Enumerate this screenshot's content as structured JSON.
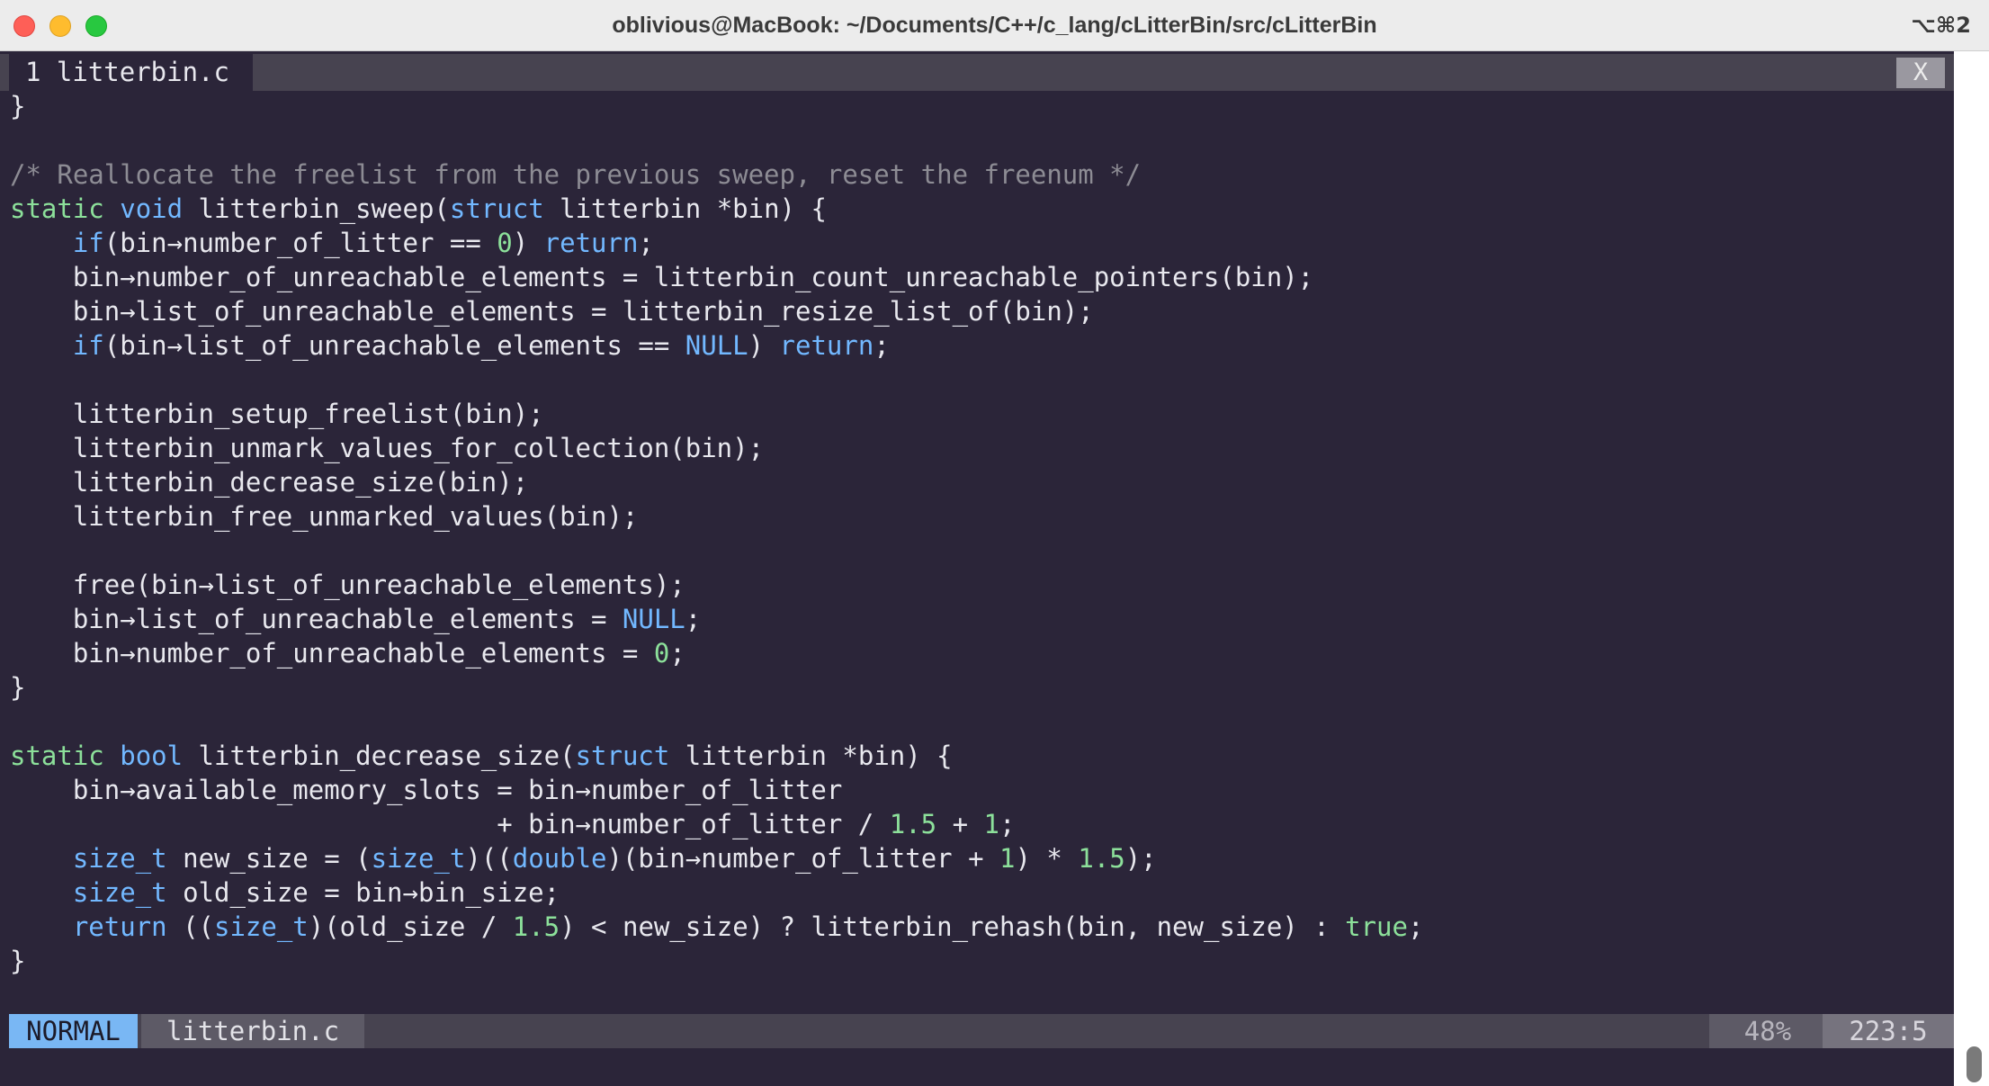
{
  "window": {
    "title": "oblivious@MacBook: ~/Documents/C++/c_lang/cLitterBin/src/cLitterBin",
    "shortcut": "⌥⌘2"
  },
  "tabline": {
    "active_tab": "1 litterbin.c",
    "close_label": "X"
  },
  "code_lines": [
    [
      {
        "t": "}",
        "c": "plain"
      }
    ],
    [],
    [
      {
        "t": "/* Reallocate the freelist from the previous sweep, reset the freenum */",
        "c": "cmt"
      }
    ],
    [
      {
        "t": "static",
        "c": "kw"
      },
      {
        "t": " ",
        "c": "plain"
      },
      {
        "t": "void",
        "c": "ty"
      },
      {
        "t": " litterbin_sweep(",
        "c": "plain"
      },
      {
        "t": "struct",
        "c": "ty"
      },
      {
        "t": " litterbin *bin) {",
        "c": "plain"
      }
    ],
    [
      {
        "t": "    ",
        "c": "plain"
      },
      {
        "t": "if",
        "c": "ty"
      },
      {
        "t": "(bin→number_of_litter == ",
        "c": "plain"
      },
      {
        "t": "0",
        "c": "num"
      },
      {
        "t": ") ",
        "c": "plain"
      },
      {
        "t": "return",
        "c": "ty"
      },
      {
        "t": ";",
        "c": "plain"
      }
    ],
    [
      {
        "t": "    bin→number_of_unreachable_elements = litterbin_count_unreachable_pointers(bin);",
        "c": "plain"
      }
    ],
    [
      {
        "t": "    bin→list_of_unreachable_elements = litterbin_resize_list_of(bin);",
        "c": "plain"
      }
    ],
    [
      {
        "t": "    ",
        "c": "plain"
      },
      {
        "t": "if",
        "c": "ty"
      },
      {
        "t": "(bin→list_of_unreachable_elements == ",
        "c": "plain"
      },
      {
        "t": "NULL",
        "c": "ty"
      },
      {
        "t": ") ",
        "c": "plain"
      },
      {
        "t": "return",
        "c": "ty"
      },
      {
        "t": ";",
        "c": "plain"
      }
    ],
    [],
    [
      {
        "t": "    litterbin_setup_freelist(bin);",
        "c": "plain"
      }
    ],
    [
      {
        "t": "    litterbin_unmark_values_for_collection(bin);",
        "c": "plain"
      }
    ],
    [
      {
        "t": "    litterbin_decrease_size(bin);",
        "c": "plain"
      }
    ],
    [
      {
        "t": "    litterbin_free_unmarked_values(bin);",
        "c": "plain"
      }
    ],
    [],
    [
      {
        "t": "    free(bin→list_of_unreachable_elements);",
        "c": "plain"
      }
    ],
    [
      {
        "t": "    bin→list_of_unreachable_elements = ",
        "c": "plain"
      },
      {
        "t": "NULL",
        "c": "ty"
      },
      {
        "t": ";",
        "c": "plain"
      }
    ],
    [
      {
        "t": "    bin→number_of_unreachable_elements = ",
        "c": "plain"
      },
      {
        "t": "0",
        "c": "num"
      },
      {
        "t": ";",
        "c": "plain"
      }
    ],
    [
      {
        "t": "}",
        "c": "plain"
      }
    ],
    [],
    [
      {
        "t": "static",
        "c": "kw"
      },
      {
        "t": " ",
        "c": "plain"
      },
      {
        "t": "bool",
        "c": "ty"
      },
      {
        "t": " litterbin_decrease_size(",
        "c": "plain"
      },
      {
        "t": "struct",
        "c": "ty"
      },
      {
        "t": " litterbin *bin) {",
        "c": "plain"
      }
    ],
    [
      {
        "t": "    bin→available_memory_slots = bin→number_of_litter",
        "c": "plain"
      }
    ],
    [
      {
        "t": "                               + bin→number_of_litter / ",
        "c": "plain"
      },
      {
        "t": "1.5",
        "c": "num"
      },
      {
        "t": " + ",
        "c": "plain"
      },
      {
        "t": "1",
        "c": "num"
      },
      {
        "t": ";",
        "c": "plain"
      }
    ],
    [
      {
        "t": "    ",
        "c": "plain"
      },
      {
        "t": "size_t",
        "c": "ty"
      },
      {
        "t": " new_size = (",
        "c": "plain"
      },
      {
        "t": "size_t",
        "c": "ty"
      },
      {
        "t": ")((",
        "c": "plain"
      },
      {
        "t": "double",
        "c": "ty"
      },
      {
        "t": ")(bin→number_of_litter + ",
        "c": "plain"
      },
      {
        "t": "1",
        "c": "num"
      },
      {
        "t": ") * ",
        "c": "plain"
      },
      {
        "t": "1.5",
        "c": "num"
      },
      {
        "t": ");",
        "c": "plain"
      }
    ],
    [
      {
        "t": "    ",
        "c": "plain"
      },
      {
        "t": "size_t",
        "c": "ty"
      },
      {
        "t": " old_size = bin→bin_size;",
        "c": "plain"
      }
    ],
    [
      {
        "t": "    ",
        "c": "plain"
      },
      {
        "t": "return",
        "c": "ty"
      },
      {
        "t": " ((",
        "c": "plain"
      },
      {
        "t": "size_t",
        "c": "ty"
      },
      {
        "t": ")(old_size / ",
        "c": "plain"
      },
      {
        "t": "1.5",
        "c": "num"
      },
      {
        "t": ") < new_size) ? litterbin_rehash(bin, new_size) : ",
        "c": "plain"
      },
      {
        "t": "true",
        "c": "kw"
      },
      {
        "t": ";",
        "c": "plain"
      }
    ],
    [
      {
        "t": "}",
        "c": "plain"
      }
    ]
  ],
  "statusline": {
    "mode": "NORMAL",
    "filename": "litterbin.c",
    "percent": "48%",
    "position": "223:5"
  },
  "colors": {
    "background": "#2b2539",
    "keyword_green": "#8ce09a",
    "type_blue": "#72b8ff",
    "comment_gray": "#8d8c94",
    "mode_blue": "#79b7f4"
  }
}
